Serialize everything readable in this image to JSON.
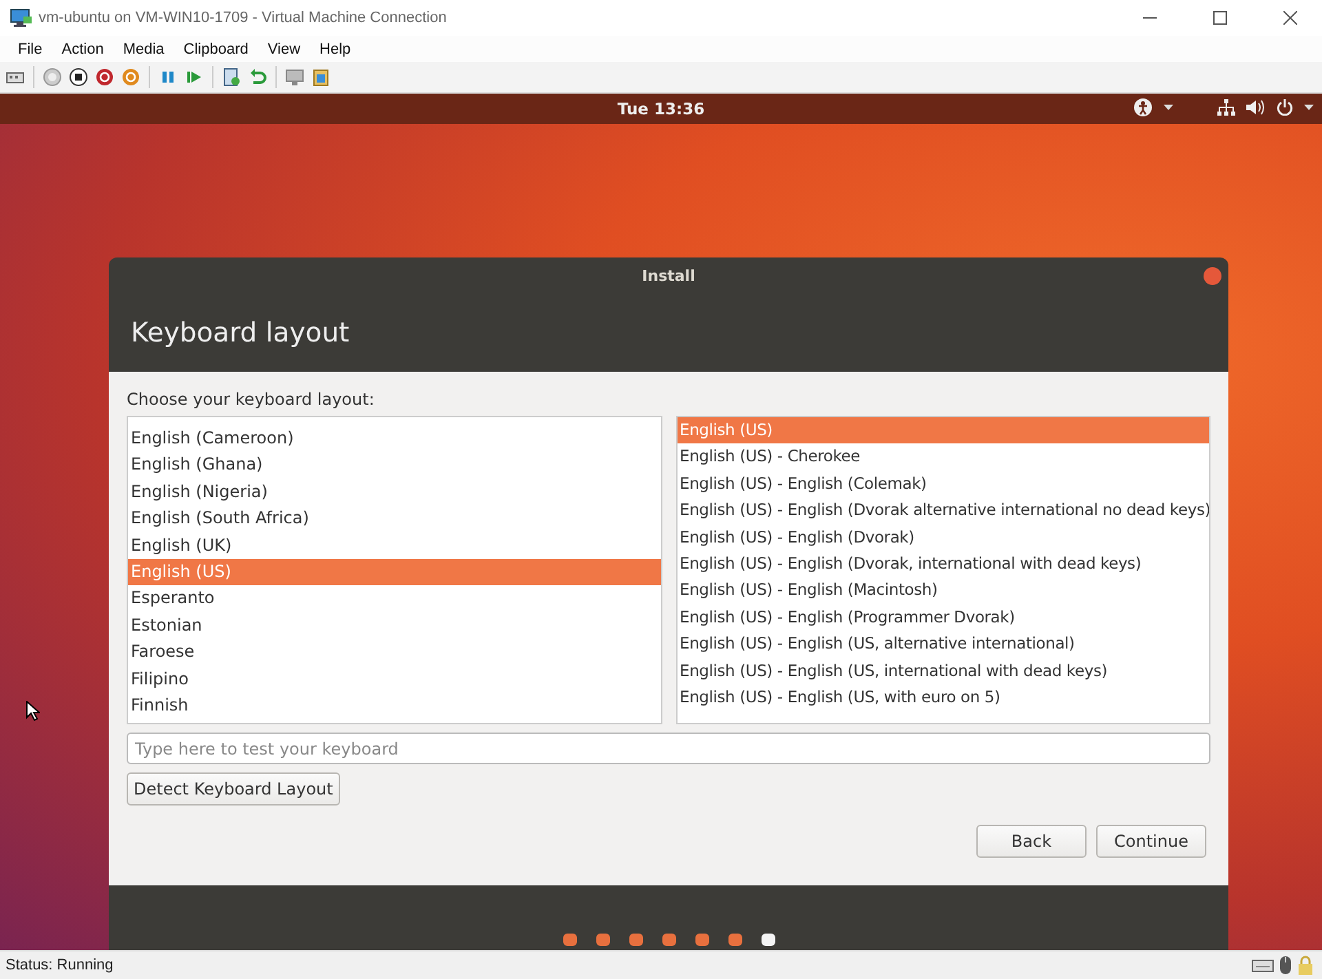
{
  "host_window": {
    "title": "vm-ubuntu on VM-WIN10-1709 - Virtual Machine Connection"
  },
  "menu_bar": [
    "File",
    "Action",
    "Media",
    "Clipboard",
    "View",
    "Help"
  ],
  "ubuntu_panel": {
    "clock": "Tue 13:36"
  },
  "installer": {
    "title": "Install",
    "heading": "Keyboard layout",
    "prompt": "Choose your keyboard layout:",
    "layouts": [
      {
        "label": "English (Cameroon)",
        "selected": false
      },
      {
        "label": "English (Ghana)",
        "selected": false
      },
      {
        "label": "English (Nigeria)",
        "selected": false
      },
      {
        "label": "English (South Africa)",
        "selected": false
      },
      {
        "label": "English (UK)",
        "selected": false
      },
      {
        "label": "English (US)",
        "selected": true
      },
      {
        "label": "Esperanto",
        "selected": false
      },
      {
        "label": "Estonian",
        "selected": false
      },
      {
        "label": "Faroese",
        "selected": false
      },
      {
        "label": "Filipino",
        "selected": false
      },
      {
        "label": "Finnish",
        "selected": false
      }
    ],
    "variants": [
      {
        "label": "English (US)",
        "selected": true
      },
      {
        "label": "English (US) - Cherokee",
        "selected": false
      },
      {
        "label": "English (US) - English (Colemak)",
        "selected": false
      },
      {
        "label": "English (US) - English (Dvorak alternative international no dead keys)",
        "selected": false
      },
      {
        "label": "English (US) - English (Dvorak)",
        "selected": false
      },
      {
        "label": "English (US) - English (Dvorak, international with dead keys)",
        "selected": false
      },
      {
        "label": "English (US) - English (Macintosh)",
        "selected": false
      },
      {
        "label": "English (US) - English (Programmer Dvorak)",
        "selected": false
      },
      {
        "label": "English (US) - English (US, alternative international)",
        "selected": false
      },
      {
        "label": "English (US) - English (US, international with dead keys)",
        "selected": false
      },
      {
        "label": "English (US) - English (US, with euro on 5)",
        "selected": false
      }
    ],
    "test_field": {
      "placeholder": "Type here to test your keyboard"
    },
    "detect_button": "Detect Keyboard Layout",
    "buttons": [
      "Back",
      "Continue"
    ],
    "steps": [
      {
        "current": false
      },
      {
        "current": false
      },
      {
        "current": false
      },
      {
        "current": false
      },
      {
        "current": false
      },
      {
        "current": false
      },
      {
        "current": true
      }
    ]
  },
  "status_bar": {
    "status": "Status: Running"
  }
}
